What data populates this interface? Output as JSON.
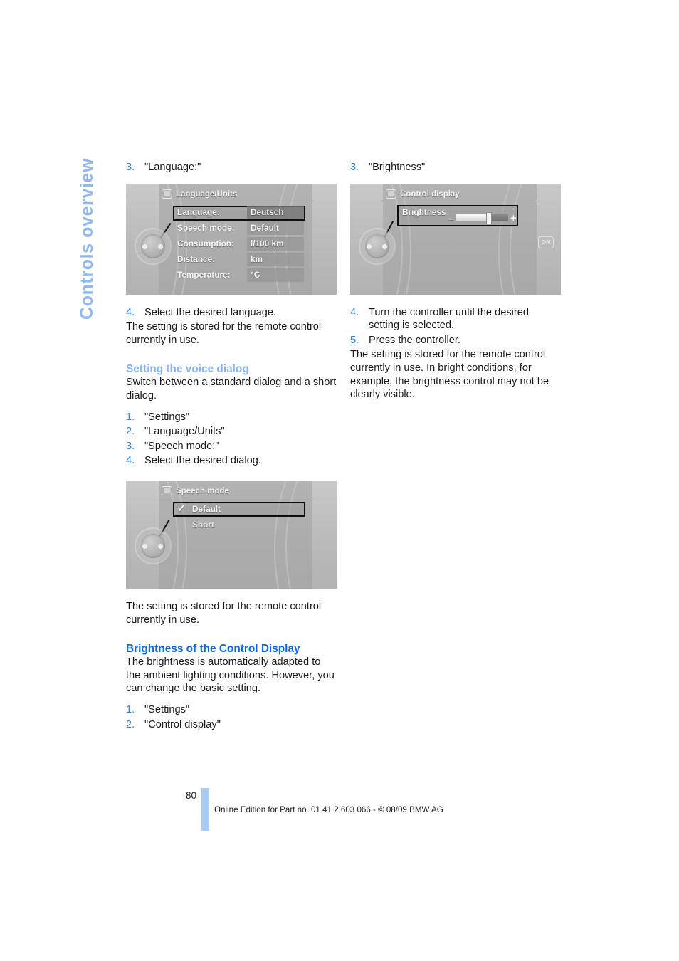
{
  "chapter": {
    "title": "Controls overview"
  },
  "footer": {
    "page_number": "80",
    "edition_text": "Online Edition for Part no. 01 41 2 603 066 - © 08/09 BMW AG"
  },
  "colors": {
    "chapter_blue": "#8FB8F0",
    "heading_light_blue": "#89B4F2",
    "heading_blue": "#0B68E6",
    "list_number_blue": "#2C86E0",
    "footer_bar_blue": "#A9CCF5"
  },
  "left_column": {
    "step3": {
      "num": "3.",
      "text": "\"Language:\""
    },
    "figure_language": {
      "caption_none": "",
      "header": "Language/Units",
      "rows": [
        {
          "label": "Language:",
          "value": "Deutsch",
          "selected": true
        },
        {
          "label": "Speech mode:",
          "value": "Default",
          "selected": false
        },
        {
          "label": "Consumption:",
          "value": "l/100 km",
          "selected": false
        },
        {
          "label": "Distance:",
          "value": "km",
          "selected": false
        },
        {
          "label": "Temperature:",
          "value": "°C",
          "selected": false
        }
      ]
    },
    "step4": {
      "num": "4.",
      "text": "Select the desired language."
    },
    "note1": "The setting is stored for the remote control currently in use.",
    "heading_voice": "Setting the voice dialog",
    "voice_intro": "Switch between a standard dialog and a short dialog.",
    "voice_steps": [
      {
        "num": "1.",
        "text": "\"Settings\""
      },
      {
        "num": "2.",
        "text": "\"Language/Units\""
      },
      {
        "num": "3.",
        "text": "\"Speech mode:\""
      },
      {
        "num": "4.",
        "text": "Select the desired dialog."
      }
    ],
    "figure_speech": {
      "header": "Speech mode",
      "options": [
        {
          "label": "Default",
          "checked": true,
          "selected": true
        },
        {
          "label": "Short",
          "checked": false,
          "selected": false
        }
      ]
    },
    "note2": "The setting is stored for the remote control currently in use.",
    "heading_brightness": "Brightness of the Control Display",
    "brightness_intro": "The brightness is automatically adapted to the ambient lighting conditions. However, you can change the basic setting.",
    "brightness_steps": [
      {
        "num": "1.",
        "text": "\"Settings\""
      },
      {
        "num": "2.",
        "text": "\"Control display\""
      }
    ]
  },
  "right_column": {
    "step3": {
      "num": "3.",
      "text": "\"Brightness\""
    },
    "figure_control_display": {
      "header": "Control display",
      "row_label": "Brightness",
      "slider": {
        "minus": "–",
        "plus": "+",
        "fill_percent": 62
      },
      "on_badge": "ON"
    },
    "steps": [
      {
        "num": "4.",
        "text": "Turn the controller until the desired setting is selected."
      },
      {
        "num": "5.",
        "text": "Press the controller."
      }
    ],
    "note": "The setting is stored for the remote control currently in use. In bright conditions, for example, the brightness control may not be clearly visible."
  }
}
